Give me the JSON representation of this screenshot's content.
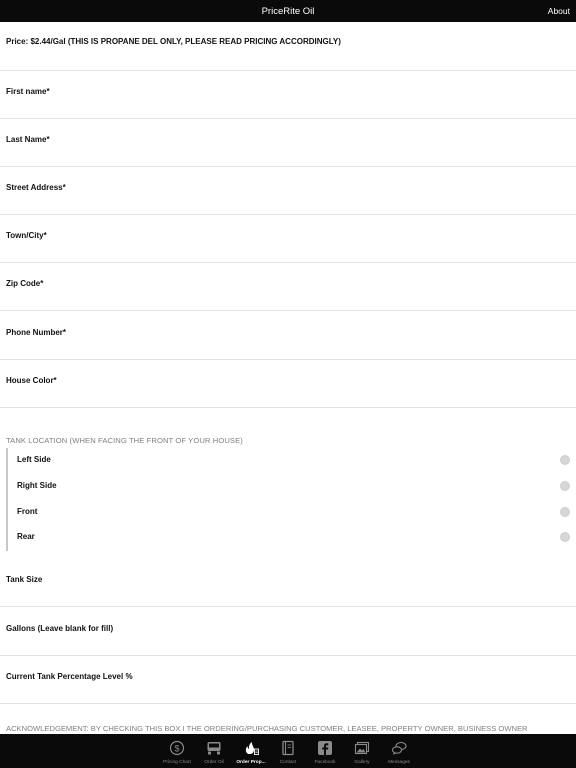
{
  "header": {
    "title": "PriceRite Oil",
    "about_label": "About"
  },
  "form": {
    "price_label": "Price: $2.44/Gal (THIS IS PROPANE DEL ONLY, PLEASE READ PRICING ACCORDINGLY)",
    "fields": [
      {
        "label": "First name*",
        "value": ""
      },
      {
        "label": "Last Name*",
        "value": ""
      },
      {
        "label": "Street Address*",
        "value": ""
      },
      {
        "label": "Town/City*",
        "value": ""
      },
      {
        "label": "Zip Code*",
        "value": ""
      },
      {
        "label": "Phone Number*",
        "value": ""
      },
      {
        "label": "House Color*",
        "value": ""
      }
    ],
    "tank_location": {
      "header": "TANK LOCATION (WHEN FACING THE FRONT OF YOUR HOUSE)",
      "options": [
        "Left Side",
        "Right Side",
        "Front",
        "Rear"
      ],
      "selected": null
    },
    "fields2": [
      {
        "label": "Tank Size",
        "value": ""
      },
      {
        "label": "Gallons (Leave blank for fill)",
        "value": ""
      },
      {
        "label": "Current Tank Percentage Level %",
        "value": ""
      }
    ],
    "acknowledgement": "ACKNOWLEDGEMENT: BY CHECKING THIS BOX I THE ORDERING/PURCHASING CUSTOMER, LEASEE, PROPERTY OWNER, BUSINESS OWNER"
  },
  "tabbar": {
    "active_index": 2,
    "tabs": [
      {
        "label": "Pricing Chart",
        "icon": "dollar-icon"
      },
      {
        "label": "Order Oil",
        "icon": "truck-icon"
      },
      {
        "label": "Order Prop...",
        "icon": "flame-icon"
      },
      {
        "label": "Contact",
        "icon": "address-book-icon"
      },
      {
        "label": "Facebook",
        "icon": "facebook-icon"
      },
      {
        "label": "Gallery",
        "icon": "gallery-icon"
      },
      {
        "label": "Messages",
        "icon": "chat-bubbles-icon"
      }
    ]
  }
}
